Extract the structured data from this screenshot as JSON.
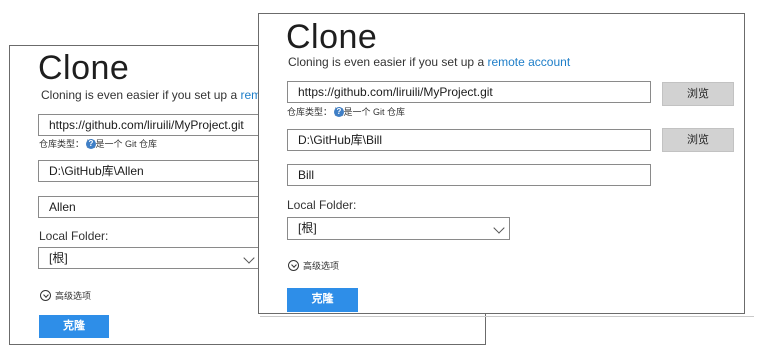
{
  "back_dialog": {
    "title": "Clone",
    "subtitle_text": "Cloning is even easier if you set up a ",
    "subtitle_link": "remo",
    "url_value": "https://github.com/liruili/MyProject.git",
    "repo_type_hint": "仓库类型：  这是一个 Git 仓库",
    "path_value": "D:\\GitHub库\\Allen",
    "name_value": "Allen",
    "local_folder_label": "Local Folder:",
    "local_folder_value": "[根]",
    "advanced_label": "高级选项",
    "clone_button": "克隆"
  },
  "front_dialog": {
    "title": "Clone",
    "subtitle_text": "Cloning is even easier if you set up a ",
    "subtitle_link": "remote account",
    "url_value": "https://github.com/liruili/MyProject.git",
    "browse_url_button": "浏览",
    "repo_type_hint": "仓库类型：  这是一个 Git 仓库",
    "path_value": "D:\\GitHub库\\Bill",
    "browse_path_button": "浏览",
    "name_value": "Bill",
    "local_folder_label": "Local Folder:",
    "local_folder_value": "[根]",
    "advanced_label": "高级选项",
    "clone_button": "克隆"
  },
  "colors": {
    "accent": "#2e8ee8",
    "link": "#1e7ec8",
    "help_icon": "#3f7fc6",
    "browse_button": "#d2d2d2"
  },
  "icons": [
    "help-icon",
    "chevron-down-icon",
    "expand-circle-icon"
  ]
}
